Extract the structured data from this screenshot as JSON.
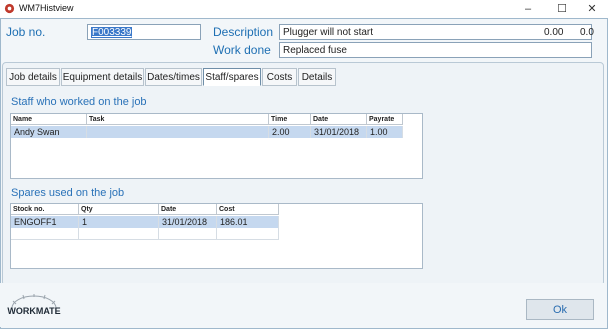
{
  "window": {
    "title": "WM7Histview",
    "minimize": "–",
    "maximize": "☐",
    "close": "✕"
  },
  "header": {
    "job_no_label": "Job no.",
    "job_no_value": "F003339",
    "description_label": "Description",
    "description_value": "Plugger will not start",
    "value_1": "0.00",
    "value_2": "0.0",
    "work_done_label": "Work done",
    "work_done_value": "Replaced fuse"
  },
  "tabs": [
    {
      "label": "Job details"
    },
    {
      "label": "Equipment details"
    },
    {
      "label": "Dates/times"
    },
    {
      "label": "Staff/spares"
    },
    {
      "label": "Costs"
    },
    {
      "label": "Details"
    }
  ],
  "active_tab": "Staff/spares",
  "staff": {
    "title": "Staff who worked on the job",
    "columns": [
      "Name",
      "Task",
      "Time",
      "Date",
      "Payrate"
    ],
    "rows": [
      {
        "name": "Andy Swan",
        "task": "",
        "time": "2.00",
        "date": "31/01/2018",
        "payrate": "1.00"
      }
    ]
  },
  "spares": {
    "title": "Spares used on the job",
    "columns": [
      "Stock no.",
      "Qty",
      "Date",
      "Cost"
    ],
    "rows": [
      {
        "stock_no": "ENGOFF1",
        "qty": "1",
        "date": "31/01/2018",
        "cost": "186.01"
      }
    ]
  },
  "footer": {
    "logo_text": "WORKMATE",
    "ok_label": "Ok"
  },
  "colors": {
    "accent": "#1e6fb3",
    "selection": "#c5d8ef"
  }
}
